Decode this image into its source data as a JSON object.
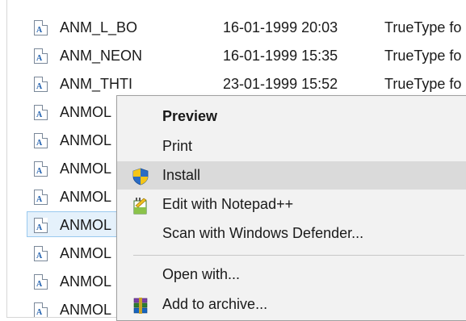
{
  "files": [
    {
      "name": "ANM_L_BO",
      "date": "16-01-1999 20:03",
      "type": "TrueType fo"
    },
    {
      "name": "ANM_NEON",
      "date": "16-01-1999 15:35",
      "type": "TrueType fo"
    },
    {
      "name": "ANM_THTI",
      "date": "23-01-1999 15:52",
      "type": "TrueType fo"
    },
    {
      "name": "ANMOL",
      "date": "",
      "type": ""
    },
    {
      "name": "ANMOL",
      "date": "",
      "type": ""
    },
    {
      "name": "ANMOL",
      "date": "",
      "type": ""
    },
    {
      "name": "ANMOL",
      "date": "",
      "type": ""
    },
    {
      "name": "ANMOL",
      "date": "",
      "type": "",
      "selected": true
    },
    {
      "name": "ANMOL",
      "date": "",
      "type": ""
    },
    {
      "name": "ANMOL",
      "date": "",
      "type": ""
    },
    {
      "name": "ANMOL",
      "date": "",
      "type": ""
    }
  ],
  "context_menu": {
    "preview": "Preview",
    "print": "Print",
    "install": "Install",
    "edit_notepad": "Edit with Notepad++",
    "scan_defender": "Scan with Windows Defender...",
    "open_with": "Open with...",
    "add_archive": "Add to archive..."
  },
  "colors": {
    "selection_bg": "#e5f1fb",
    "selection_border": "#99c9ef",
    "menu_bg": "#f2f2f2",
    "menu_hover": "#dadada"
  },
  "icons": {
    "file": "truetype-font-file-icon",
    "install": "uac-shield-icon",
    "notepad": "notepad-plus-plus-icon",
    "archive": "winrar-archive-icon"
  }
}
